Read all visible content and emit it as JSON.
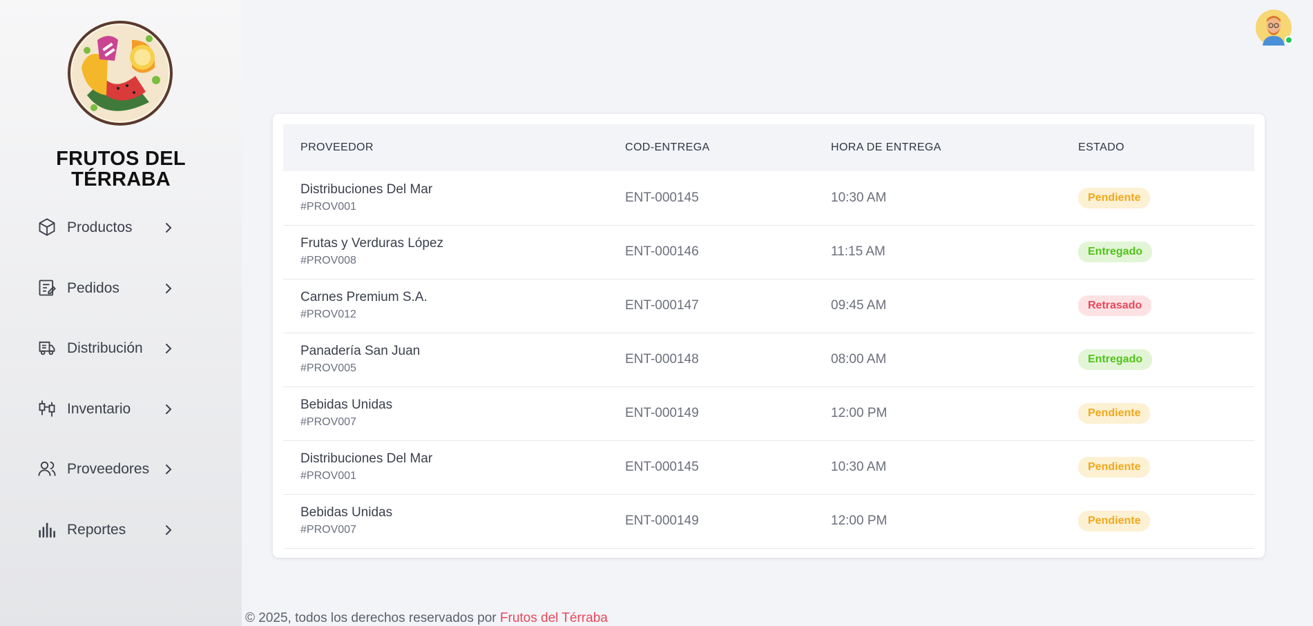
{
  "brand": {
    "line1": "FRUTOS DEL",
    "line2": "TÉRRABA",
    "logo_icon": "fruit-logo-icon"
  },
  "nav": [
    {
      "label": "Productos",
      "icon": "box-icon"
    },
    {
      "label": "Pedidos",
      "icon": "edit-note-icon"
    },
    {
      "label": "Distribución",
      "icon": "truck-icon"
    },
    {
      "label": "Inventario",
      "icon": "candlestick-icon"
    },
    {
      "label": "Proveedores",
      "icon": "users-icon"
    },
    {
      "label": "Reportes",
      "icon": "bar-chart-icon"
    }
  ],
  "user": {
    "avatar_icon": "user-avatar-icon",
    "status_color": "#22c55e"
  },
  "table": {
    "headers": {
      "proveedor": "PROVEEDOR",
      "cod": "COD-ENTREGA",
      "hora": "HORA DE ENTREGA",
      "estado": "ESTADO"
    },
    "rows": [
      {
        "name": "Distribuciones Del Mar",
        "id": "#PROV001",
        "cod": "ENT-000145",
        "hora": "10:30 AM",
        "estado": "Pendiente"
      },
      {
        "name": "Frutas y Verduras López",
        "id": "#PROV008",
        "cod": "ENT-000146",
        "hora": "11:15 AM",
        "estado": "Entregado"
      },
      {
        "name": "Carnes Premium S.A.",
        "id": "#PROV012",
        "cod": "ENT-000147",
        "hora": "09:45 AM",
        "estado": "Retrasado"
      },
      {
        "name": "Panadería San Juan",
        "id": "#PROV005",
        "cod": "ENT-000148",
        "hora": "08:00 AM",
        "estado": "Entregado"
      },
      {
        "name": "Bebidas Unidas",
        "id": "#PROV007",
        "cod": "ENT-000149",
        "hora": "12:00 PM",
        "estado": "Pendiente"
      },
      {
        "name": "Distribuciones Del Mar",
        "id": "#PROV001",
        "cod": "ENT-000145",
        "hora": "10:30 AM",
        "estado": "Pendiente"
      },
      {
        "name": "Bebidas Unidas",
        "id": "#PROV007",
        "cod": "ENT-000149",
        "hora": "12:00 PM",
        "estado": "Pendiente"
      }
    ]
  },
  "status_colors": {
    "Pendiente": {
      "bg": "#fdf1d4",
      "fg": "#f0a81c"
    },
    "Entregado": {
      "bg": "#e2f5d6",
      "fg": "#52c41a"
    },
    "Retrasado": {
      "bg": "#fde2e4",
      "fg": "#e8475a"
    }
  },
  "footer": {
    "text": "© 2025, todos los derechos reservados por ",
    "link": "Frutos del Térraba",
    "link_color": "#e8475a"
  }
}
